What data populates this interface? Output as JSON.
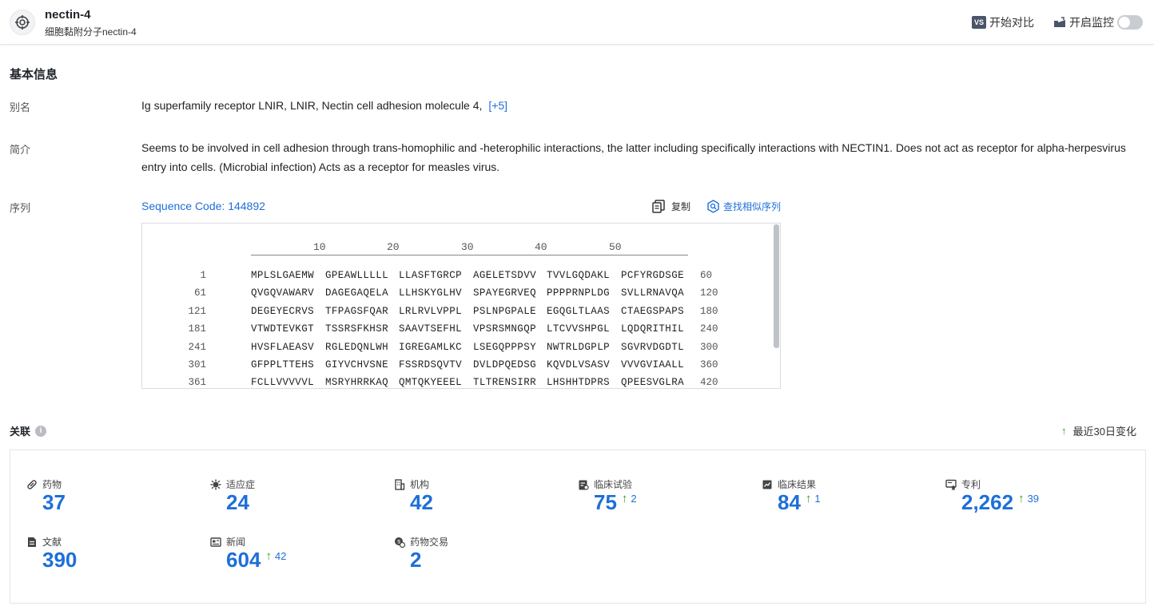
{
  "header": {
    "title": "nectin-4",
    "subtitle": "细胞黏附分子nectin-4",
    "compare_icon": "VS",
    "compare_label": "开始对比",
    "monitor_label": "开启监控"
  },
  "basic_info": {
    "section_title": "基本信息",
    "alias_label": "别名",
    "alias_value": "Ig superfamily receptor LNIR,  LNIR,  Nectin cell adhesion molecule 4,",
    "alias_more": "[+5]",
    "summary_label": "简介",
    "summary_line1": "Seems to be involved in cell adhesion through trans-homophilic and -heterophilic interactions, the latter including specifically interactions with NECTIN1. Does not act as receptor for alpha-herpesvirus",
    "summary_line2": "entry into cells. (Microbial infection) Acts as a receptor for measles virus.",
    "sequence_label": "序列",
    "sequence_code": "Sequence Code: 144892",
    "copy_label": "复制",
    "find_similar_label": "查找相似序列"
  },
  "sequence": {
    "ruler": [
      "10",
      "20",
      "30",
      "40",
      "50"
    ],
    "rows": [
      {
        "start": "1",
        "blocks": [
          "MPLSLGAEMW",
          "GPEAWLLLLL",
          "LLASFTGRCP",
          "AGELETSDVV",
          "TVVLGQDAKL",
          "PCFYRGDSGE"
        ],
        "end": "60"
      },
      {
        "start": "61",
        "blocks": [
          "QVGQVAWARV",
          "DAGEGAQELA",
          "LLHSKYGLHV",
          "SPAYEGRVEQ",
          "PPPPRNPLDG",
          "SVLLRNAVQA"
        ],
        "end": "120"
      },
      {
        "start": "121",
        "blocks": [
          "DEGEYECRVS",
          "TFPAGSFQAR",
          "LRLRVLVPPL",
          "PSLNPGPALE",
          "EGQGLTLAAS",
          "CTAEGSPAPS"
        ],
        "end": "180"
      },
      {
        "start": "181",
        "blocks": [
          "VTWDTEVKGT",
          "TSSRSFKHSR",
          "SAAVTSEFHL",
          "VPSRSMNGQP",
          "LTCVVSHPGL",
          "LQDQRITHIL"
        ],
        "end": "240"
      },
      {
        "start": "241",
        "blocks": [
          "HVSFLAEASV",
          "RGLEDQNLWH",
          "IGREGAMLKC",
          "LSEGQPPPSY",
          "NWTRLDGPLP",
          "SGVRVDGDTL"
        ],
        "end": "300"
      },
      {
        "start": "301",
        "blocks": [
          "GFPPLTTEHS",
          "GIYVCHVSNE",
          "FSSRDSQVTV",
          "DVLDPQEDSG",
          "KQVDLVSASV",
          "VVVGVIAALL"
        ],
        "end": "360"
      },
      {
        "start": "361",
        "blocks": [
          "FCLLVVVVVL",
          "MSRYHRRKAQ",
          "QMTQKYEEEL",
          "TLTRENSIRR",
          "LHSHHTDPRS",
          "QPEESVGLRA"
        ],
        "end": "420"
      }
    ]
  },
  "relations": {
    "title": "关联",
    "legend_label": "最近30日变化",
    "metrics": [
      {
        "label": "药物",
        "icon": "pill-icon",
        "value": "37",
        "change": ""
      },
      {
        "label": "适应症",
        "icon": "virus-icon",
        "value": "24",
        "change": ""
      },
      {
        "label": "机构",
        "icon": "building-icon",
        "value": "42",
        "change": ""
      },
      {
        "label": "临床试验",
        "icon": "clipboard-icon",
        "value": "75",
        "change": "2"
      },
      {
        "label": "临床结果",
        "icon": "chart-doc-icon",
        "value": "84",
        "change": "1"
      },
      {
        "label": "专利",
        "icon": "patent-icon",
        "value": "2,262",
        "change": "39"
      },
      {
        "label": "文献",
        "icon": "document-icon",
        "value": "390",
        "change": ""
      },
      {
        "label": "新闻",
        "icon": "newspaper-icon",
        "value": "604",
        "change": "42"
      },
      {
        "label": "药物交易",
        "icon": "deal-icon",
        "value": "2",
        "change": ""
      }
    ]
  },
  "colors": {
    "accent": "#1e6fd9",
    "up": "#3a9a2a"
  }
}
